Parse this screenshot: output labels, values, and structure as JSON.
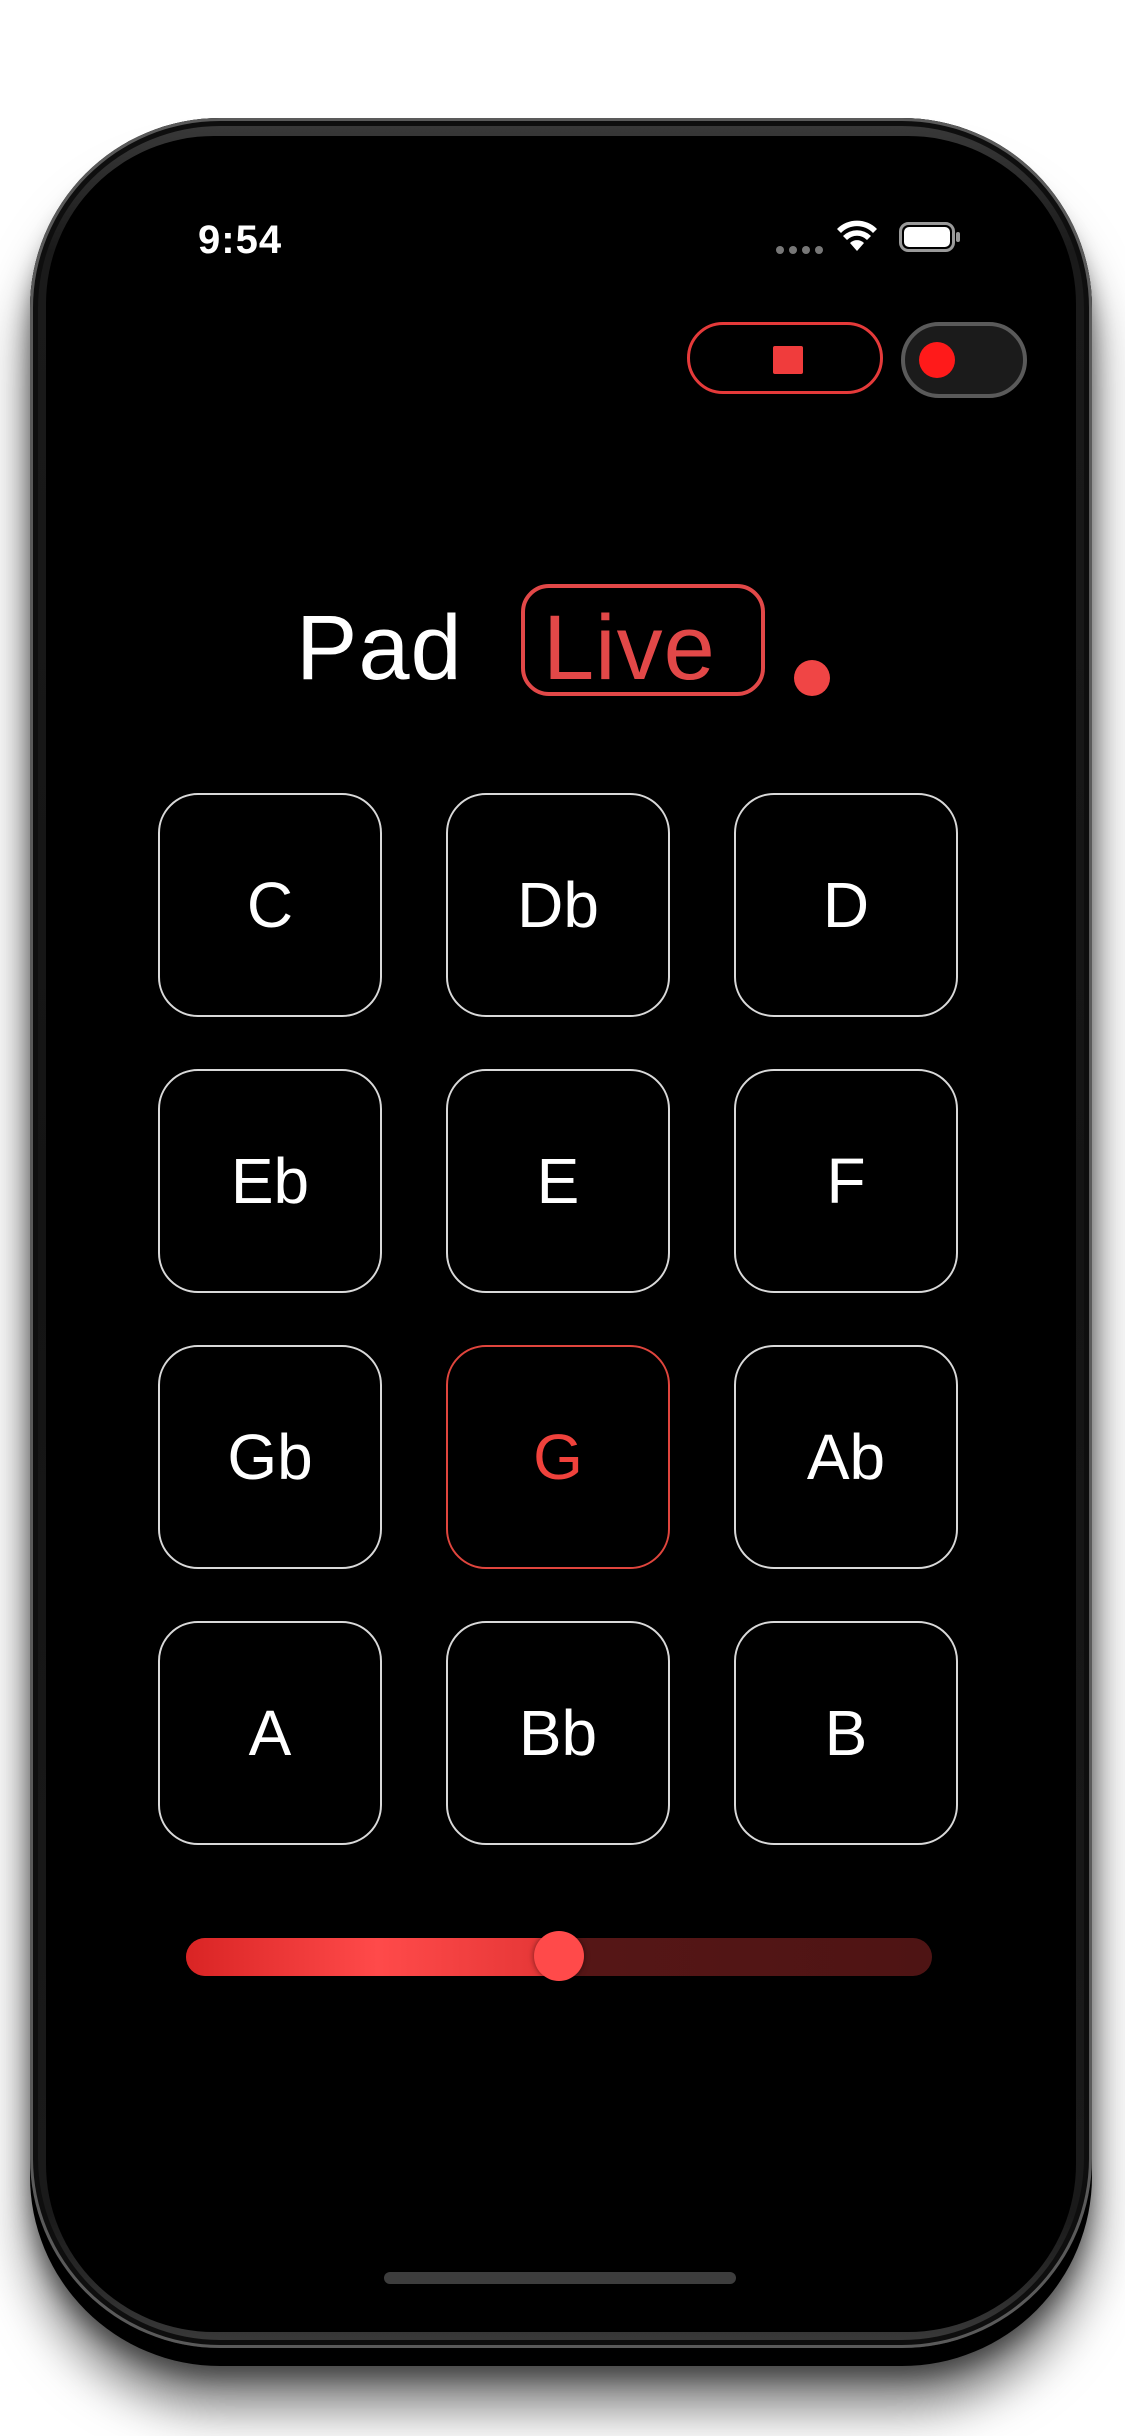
{
  "status_bar": {
    "time": "9:54",
    "icons": [
      "signal-dots-icon",
      "wifi-icon",
      "battery-icon"
    ]
  },
  "controls": {
    "stop_icon": "stop-icon",
    "record_icon": "record-icon"
  },
  "logo": {
    "word_1": "Pad",
    "word_2": "Live"
  },
  "pads": [
    {
      "label": "C",
      "active": false
    },
    {
      "label": "Db",
      "active": false
    },
    {
      "label": "D",
      "active": false
    },
    {
      "label": "Eb",
      "active": false
    },
    {
      "label": "E",
      "active": false
    },
    {
      "label": "F",
      "active": false
    },
    {
      "label": "Gb",
      "active": false
    },
    {
      "label": "G",
      "active": true
    },
    {
      "label": "Ab",
      "active": false
    },
    {
      "label": "A",
      "active": false
    },
    {
      "label": "Bb",
      "active": false
    },
    {
      "label": "B",
      "active": false
    }
  ],
  "volume": {
    "value_fraction": 0.5
  },
  "colors": {
    "background": "#000000",
    "accent": "#f0423c",
    "pad_border": "#d9d9d9",
    "pad_text": "#ffffff"
  }
}
